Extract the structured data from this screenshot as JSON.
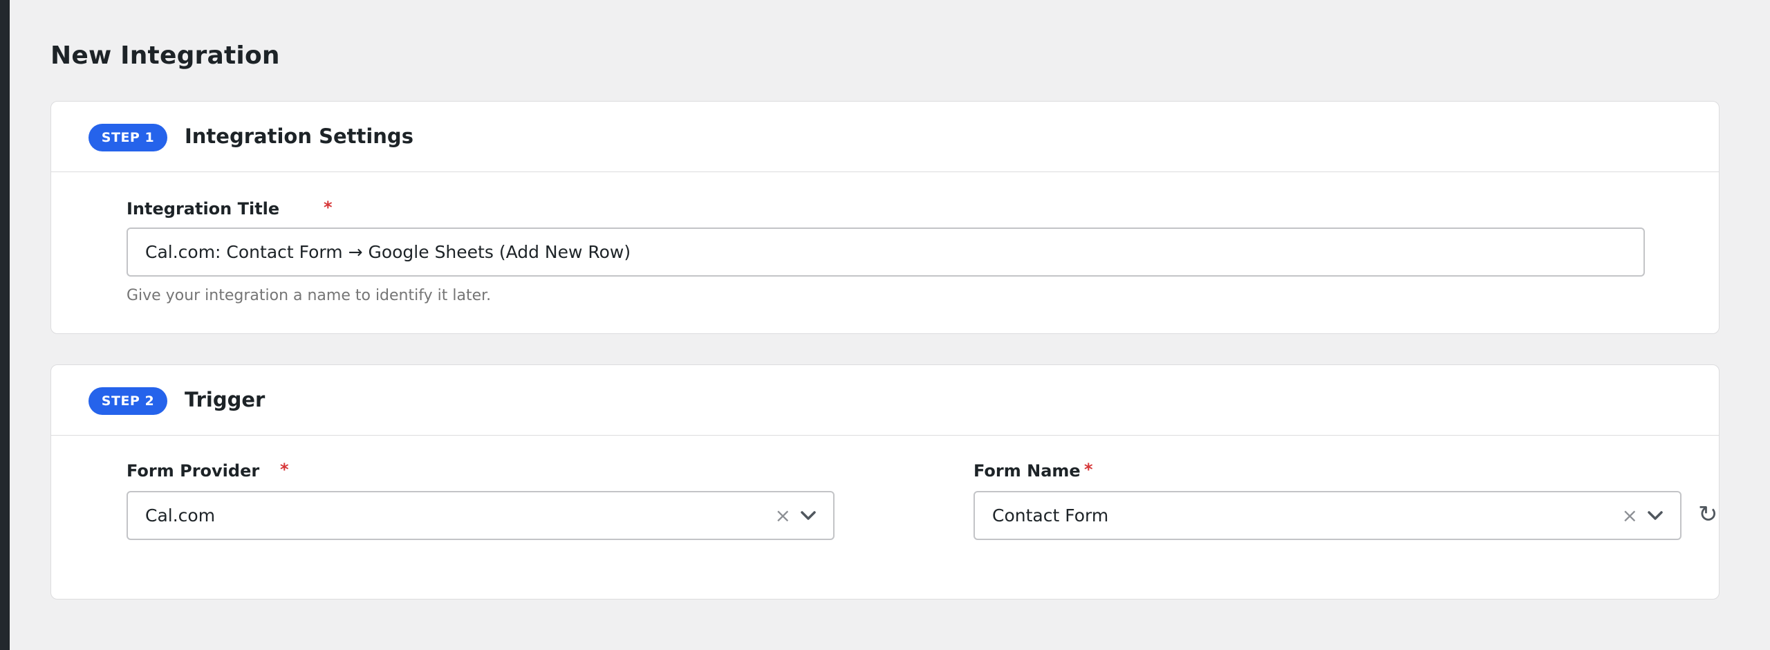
{
  "page": {
    "title": "New Integration"
  },
  "step1": {
    "badge": "STEP 1",
    "title": "Integration Settings",
    "field": {
      "label": "Integration Title",
      "required": "*",
      "value": "Cal.com: Contact Form → Google Sheets (Add New Row)",
      "help": "Give your integration a name to identify it later."
    }
  },
  "step2": {
    "badge": "STEP 2",
    "title": "Trigger",
    "provider": {
      "label": "Form Provider",
      "required": "*",
      "value": "Cal.com",
      "clear": "×",
      "icon": "chevron-down-icon"
    },
    "form": {
      "label": "Form Name",
      "required": "*",
      "value": "Contact Form",
      "clear": "×",
      "icon": "chevron-down-icon",
      "refresh": "↻"
    }
  },
  "colors": {
    "badge": "#2563eb",
    "required": "#d63638",
    "background": "#f0f0f1"
  }
}
